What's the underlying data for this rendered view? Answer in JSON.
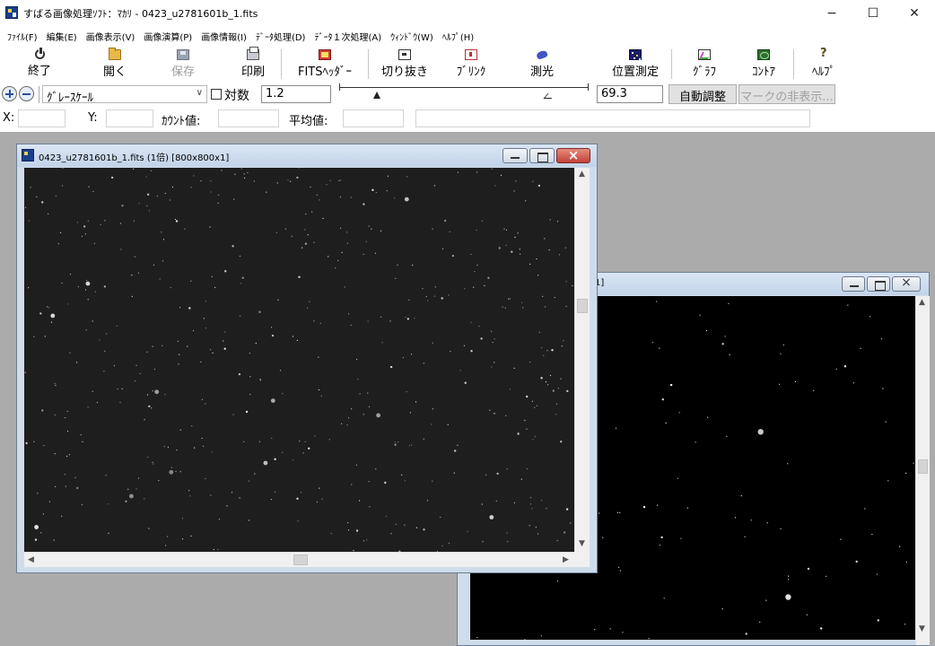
{
  "window": {
    "title": "すばる画像処理ｿﾌﾄ：ﾏｶﾘ - 0423_u2781601b_1.fits",
    "controls": {
      "minimize": "−",
      "maximize": "☐",
      "close": "✕"
    }
  },
  "menu": [
    "ﾌｧｲﾙ(F)",
    "編集(E)",
    "画像表示(V)",
    "画像演算(P)",
    "画像情報(I)",
    "ﾃﾞｰﾀ処理(D)",
    "ﾃﾞｰﾀ１次処理(A)",
    "ｳｨﾝﾄﾞｳ(W)",
    "ﾍﾙﾌﾟ(H)"
  ],
  "toolbar": {
    "exit": "終了",
    "open": "開く",
    "save": "保存",
    "print": "印刷",
    "fits_header": "FITSﾍｯﾀﾞｰ",
    "crop": "切り抜き",
    "blink": "ﾌﾞﾘﾝｸ",
    "photometry": "測光",
    "astrometry": "位置測定",
    "graph": "ｸﾞﾗﾌ",
    "contour": "ｺﾝﾄｱ",
    "help": "ﾍﾙﾌﾟ"
  },
  "controls": {
    "scale_mode": "ｸﾞﾚｰｽｹｰﾙ",
    "log_label": "対数",
    "log_checked": false,
    "min_value": "1.2",
    "max_value": "69.3",
    "auto_adjust": "自動調整",
    "hide_marks": "マークの非表示..."
  },
  "status": {
    "x_label": "X:",
    "y_label": "Y:",
    "count_label": "ｶｳﾝﾄ値:",
    "mean_label": "平均値:",
    "x_value": "",
    "y_value": "",
    "count_value": "",
    "mean_value": ""
  },
  "child1": {
    "title": "0423_u2781601b_1.fits (1倍) [800x800x1]"
  },
  "child2": {
    "title_fragment": "1]"
  },
  "colors": {
    "mdi_background": "#ababab",
    "child_frame": "#cfdceb",
    "image_background_1": "#1e1e1e",
    "image_background_2": "#000000",
    "close_button": "#c6413a"
  }
}
